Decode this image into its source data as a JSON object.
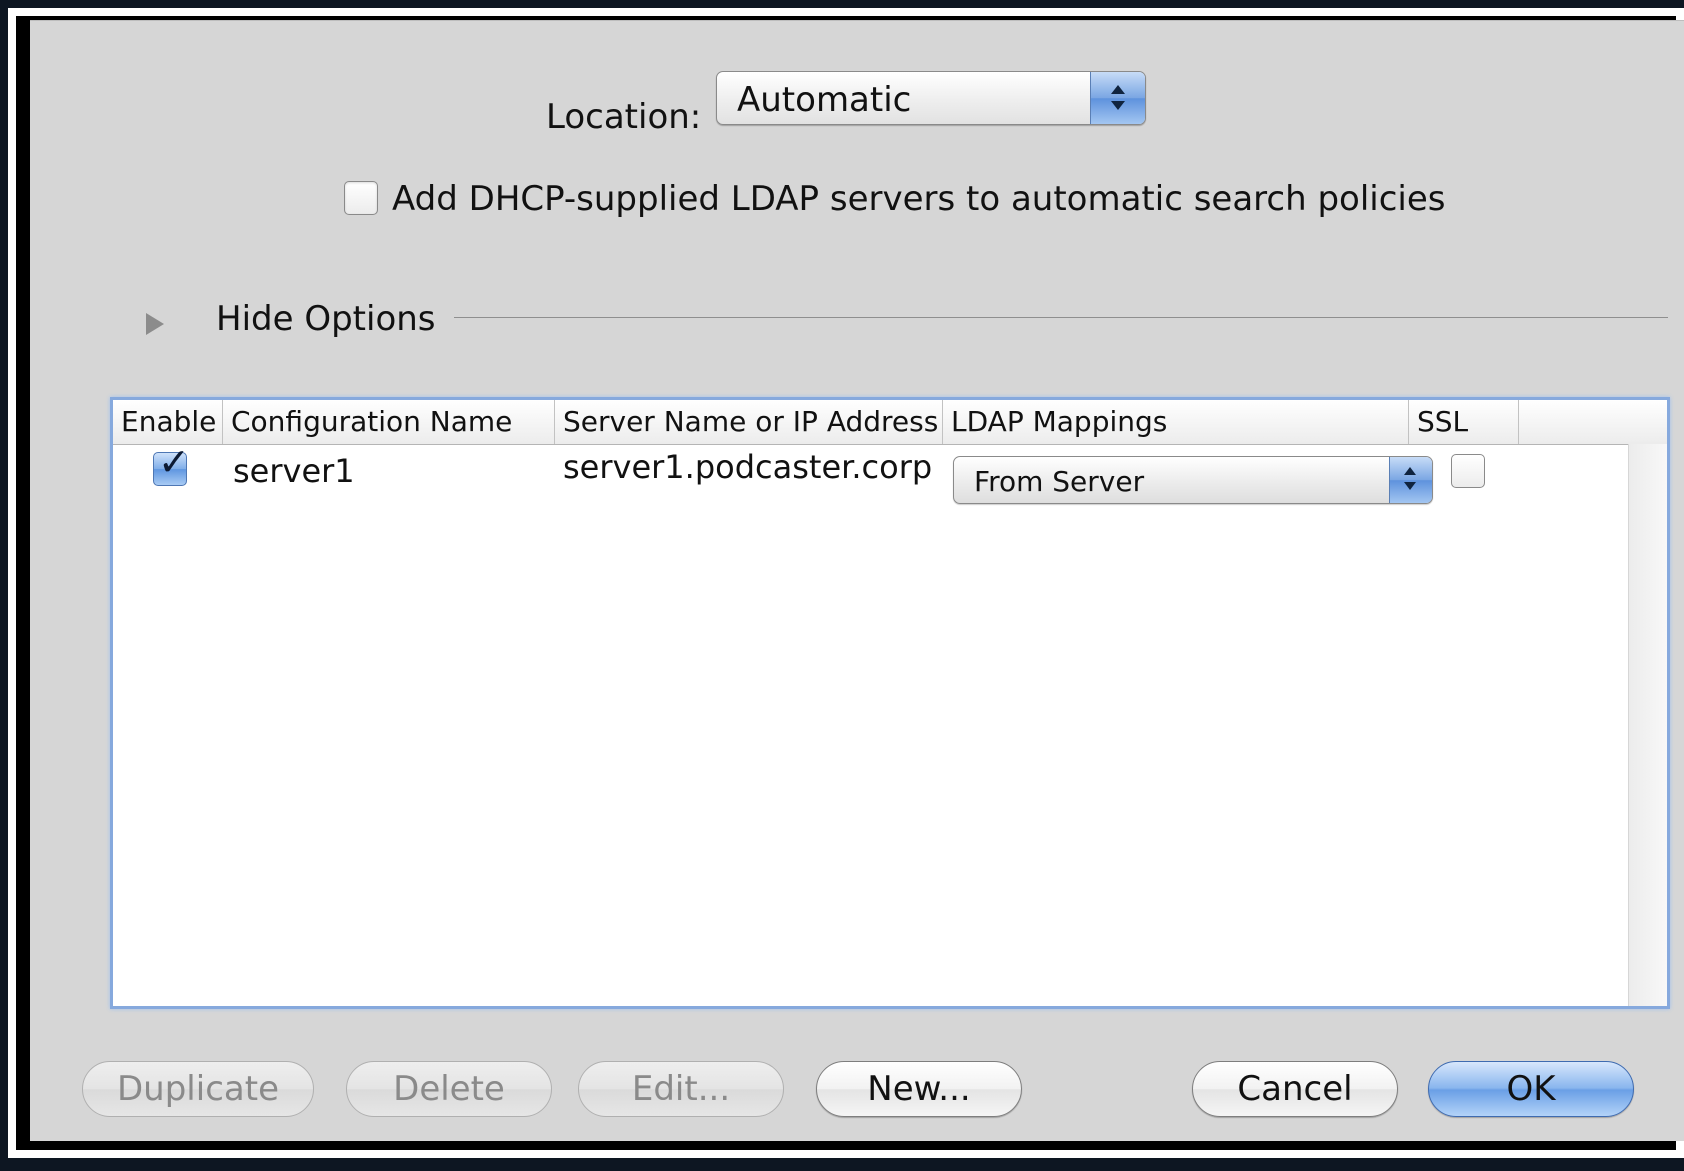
{
  "location": {
    "label": "Location:",
    "selected": "Automatic"
  },
  "dhcp": {
    "label": "Add DHCP-supplied LDAP servers to automatic search policies",
    "checked": false
  },
  "options": {
    "toggle_label": "Hide Options"
  },
  "table": {
    "columns": [
      "Enable",
      "Configuration Name",
      "Server Name or IP Address",
      "LDAP Mappings",
      "SSL"
    ],
    "rows": [
      {
        "enabled": true,
        "config_name": "server1",
        "server": "server1.podcaster.corp",
        "mapping": "From Server",
        "ssl": false
      }
    ]
  },
  "buttons": {
    "duplicate": "Duplicate",
    "delete": "Delete",
    "edit": "Edit...",
    "new": "New...",
    "cancel": "Cancel",
    "ok": "OK"
  },
  "colors": {
    "accent": "#6a9fe6",
    "sheet_background": "#d6d6d6",
    "table_focus_ring": "#86a9dd"
  }
}
